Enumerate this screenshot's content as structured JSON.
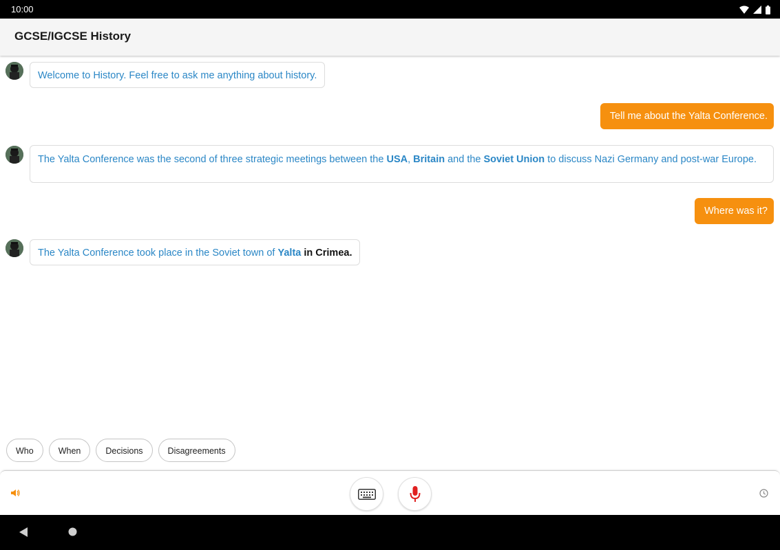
{
  "status_bar": {
    "time": "10:00",
    "icons": [
      "wifi-icon",
      "signal-icon",
      "battery-icon"
    ]
  },
  "app": {
    "title": "GCSE/IGCSE History"
  },
  "colors": {
    "accent_orange": "#f6900f",
    "bot_text_blue": "#2b87c6",
    "mic_red": "#e02020"
  },
  "conversation": {
    "bot_1": "Welcome to History. Feel free to ask me anything about history.",
    "user_1": "Tell me about the Yalta Conference.",
    "bot_2": {
      "part1": "The Yalta Conference was the second of three strategic meetings between the ",
      "bold1": "USA",
      "part2": ", ",
      "bold2": "Britain",
      "part3": " and the ",
      "bold3": "Soviet Union",
      "part4": " to discuss Nazi Germany and post-war Europe."
    },
    "user_2": "Where was it?",
    "bot_3": {
      "part1": "The Yalta Conference took place in the Soviet town of ",
      "bold1": "Yalta",
      "bold2": " in Crimea."
    }
  },
  "suggestions": [
    "Who",
    "When",
    "Decisions",
    "Disagreements"
  ],
  "controls": {
    "speaker_icon": "speaker-icon",
    "keyboard_icon": "keyboard-icon",
    "mic_icon": "microphone-icon",
    "history_icon": "clock-icon"
  }
}
